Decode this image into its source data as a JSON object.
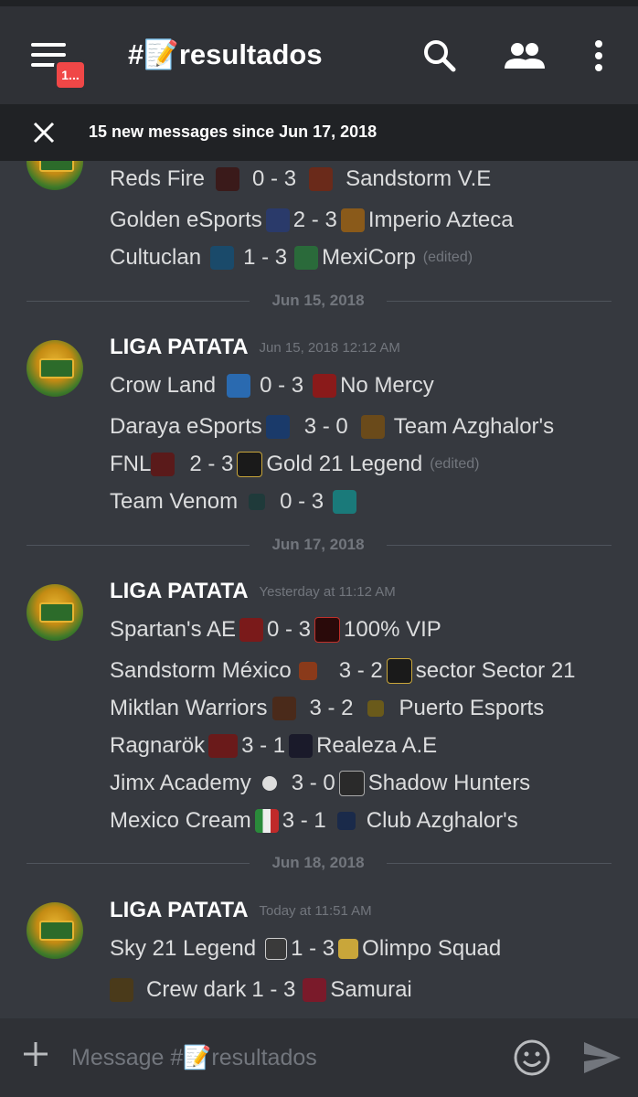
{
  "header": {
    "channel_title": "#📝resultados",
    "notification_badge": "1...",
    "icons": [
      "hamburger-menu-icon",
      "search-icon",
      "members-icon",
      "overflow-menu-icon"
    ]
  },
  "banner": {
    "text": "15 new messages since Jun 17, 2018",
    "icon": "close-icon"
  },
  "messages": {
    "top_partial_lines": [
      {
        "a": "Reds Fire",
        "s": "0 - 3",
        "b": "Sandstorm V.E",
        "edited": ""
      },
      {
        "a": "Golden eSports",
        "s": "2 - 3",
        "b": "Imperio Azteca",
        "edited": ""
      },
      {
        "a": "Cultuclan",
        "s": "1 - 3",
        "b": "MexiCorp",
        "edited": "(edited)"
      }
    ],
    "groups": [
      {
        "date": "Jun 15, 2018",
        "author": "LIGA PATATA",
        "timestamp": "Jun 15, 2018 12:12 AM",
        "lines": [
          {
            "a": "Crow Land",
            "s": "0 - 3",
            "b": "No Mercy",
            "edited": ""
          },
          {
            "a": "Daraya eSports",
            "s": "3 - 0",
            "b": "Team Azghalor's",
            "edited": ""
          },
          {
            "a": "FNL",
            "s": "2 - 3",
            "b": "Gold 21 Legend",
            "edited": "(edited)"
          },
          {
            "a": "Team Venom",
            "s": "0 - 3",
            "b": "",
            "edited": ""
          }
        ]
      },
      {
        "date": "Jun 17, 2018",
        "author": "LIGA PATATA",
        "timestamp": "Yesterday at 11:12 AM",
        "lines": [
          {
            "a": "Spartan's AE",
            "s": "0 - 3",
            "b": "100% VIP",
            "edited": ""
          },
          {
            "a": "Sandstorm México",
            "s": "3 - 2",
            "b": "sector Sector 21",
            "edited": ""
          },
          {
            "a": "Miktlan Warriors",
            "s": "3 - 2",
            "b": "Puerto Esports",
            "edited": ""
          },
          {
            "a": "Ragnarök",
            "s": "3 - 1",
            "b": "Realeza A.E",
            "edited": ""
          },
          {
            "a": "Jimx Academy",
            "s": "3 - 0",
            "b": "Shadow Hunters",
            "edited": ""
          },
          {
            "a": "Mexico Cream",
            "s": "3 - 1",
            "b": "Club Azghalor's",
            "edited": ""
          }
        ]
      },
      {
        "date": "Jun 18, 2018",
        "author": "LIGA PATATA",
        "timestamp": "Today at 11:51 AM",
        "lines": [
          {
            "a": "Sky 21 Legend",
            "s": "1 - 3",
            "b": "Olimpo Squad",
            "edited": ""
          },
          {
            "a": "Crew dark",
            "s": "1 - 3",
            "b": "Samurai",
            "edited": ""
          }
        ]
      }
    ]
  },
  "composer": {
    "placeholder": "Message #📝resultados",
    "icons": [
      "add-attachment-icon",
      "emoji-icon",
      "send-icon"
    ]
  },
  "colors": {
    "background": "#36393f",
    "header": "#2f3136",
    "banner": "#202225",
    "badge": "#f04747",
    "muted": "#72767d"
  }
}
